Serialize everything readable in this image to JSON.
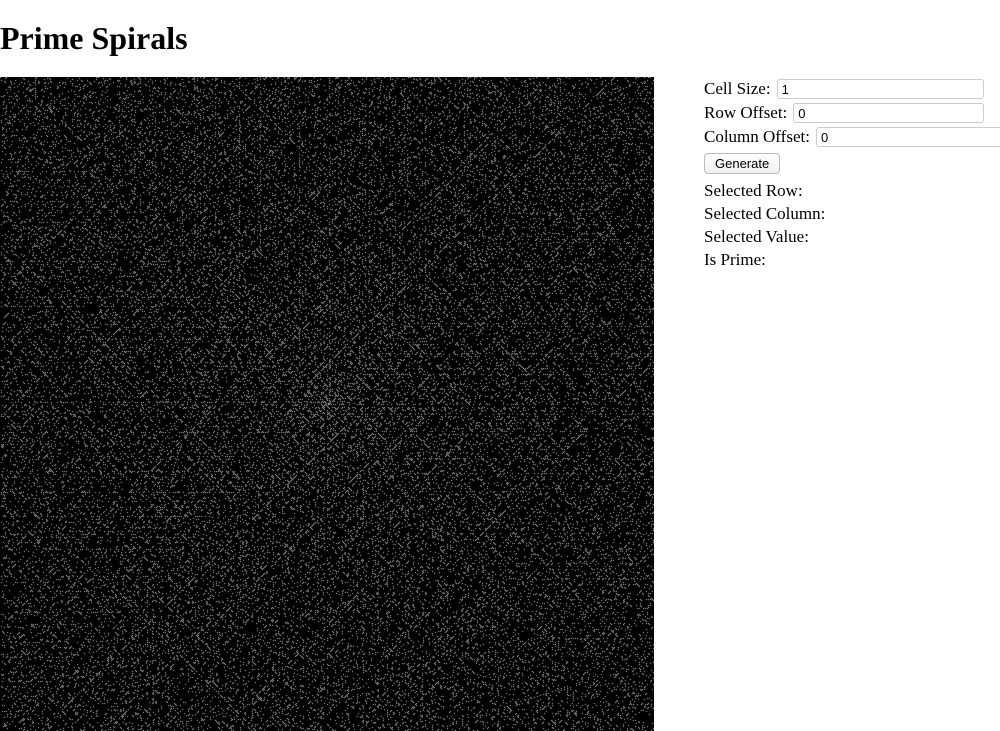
{
  "title": "Prime Spirals",
  "controls": {
    "cell_size": {
      "label": "Cell Size:",
      "value": "1"
    },
    "row_offset": {
      "label": "Row Offset:",
      "value": "0"
    },
    "column_offset": {
      "label": "Column Offset:",
      "value": "0"
    },
    "generate_label": "Generate"
  },
  "info": {
    "selected_row": {
      "label": "Selected Row:",
      "value": ""
    },
    "selected_column": {
      "label": "Selected Column:",
      "value": ""
    },
    "selected_value": {
      "label": "Selected Value:",
      "value": ""
    },
    "is_prime": {
      "label": "Is Prime:",
      "value": ""
    }
  },
  "canvas": {
    "size": 654,
    "cell_size": 1,
    "row_offset": 0,
    "column_offset": 0,
    "bg_color": "#000000",
    "prime_color": "#c9c9c9"
  }
}
